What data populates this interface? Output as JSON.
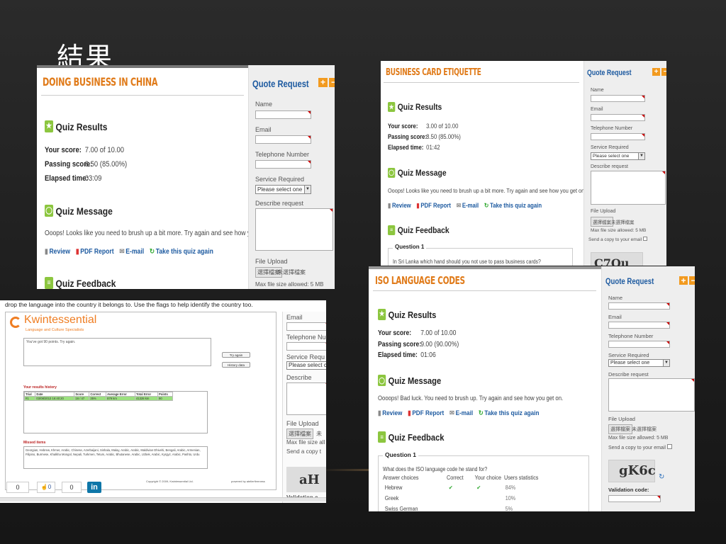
{
  "slide": {
    "title": "結果"
  },
  "quote": {
    "title": "Quote Request",
    "name": "Name",
    "email": "Email",
    "phone": "Telephone Number",
    "service": "Service Required",
    "select": "Please select one",
    "describe": "Describe request",
    "file_upload": "File Upload",
    "choose_file": "選擇檔案",
    "no_file": "未選擇檔案",
    "max_size": "Max file size allowed: 5 MB",
    "copy": "Send a copy to your email",
    "validation": "Validation code:"
  },
  "china": {
    "title": "DOING BUSINESS IN CHINA",
    "results_heading": "Quiz Results",
    "score_label": "Your score:",
    "score": "7.00 of 10.00",
    "passing_label": "Passing score:",
    "passing": "8.50 (85.00%)",
    "elapsed_label": "Elapsed time:",
    "elapsed": "03:09",
    "message_heading": "Quiz Message",
    "message": "Ooops! Looks like you need to brush up a bit more. Try again and see how you get on...",
    "feedback_heading": "Quiz Feedback",
    "links": [
      "Review",
      "PDF Report",
      "E-mail",
      "Take this quiz again"
    ],
    "max_size": "Max file size allowed: 5 MB"
  },
  "card": {
    "title": "BUSINESS CARD ETIQUETTE",
    "results_heading": "Quiz Results",
    "score_label": "Your score:",
    "score": "3.00 of 10.00",
    "passing_label": "Passing score:",
    "passing": "8.50 (85.00%)",
    "elapsed_label": "Elapsed time:",
    "elapsed": "01:42",
    "message_heading": "Quiz Message",
    "message": "Ooops! Looks like you need to brush up a bit more. Try again and see how you get on...",
    "feedback_heading": "Quiz Feedback",
    "question_label": "Question 1",
    "question": "In Sri Lanka which hand should you not use to pass business cards?",
    "links": [
      "Review",
      "PDF Report",
      "E-mail",
      "Take this quiz again"
    ],
    "max_size": "Max file size allowed: 5 MB",
    "captcha": "C7Ou"
  },
  "iso": {
    "title": "ISO LANGUAGE CODES",
    "results_heading": "Quiz Results",
    "score_label": "Your score:",
    "score": "7.00 of 10.00",
    "passing_label": "Passing score:",
    "passing": "9.00 (90.00%)",
    "elapsed_label": "Elapsed time:",
    "elapsed": "01:06",
    "message_heading": "Quiz Message",
    "message": "Oooops! Bad luck. You need to brush up. Try again and see how you get on.",
    "feedback_heading": "Quiz Feedback",
    "question_label": "Question 1",
    "question": "What does the ISO language code he stand for?",
    "cols": [
      "Answer choices",
      "Correct",
      "Your choice",
      "Users statistics"
    ],
    "answers": [
      {
        "choice": "Hebrew",
        "correct": "✔",
        "yours": "✔",
        "stat": "84%"
      },
      {
        "choice": "Greek",
        "correct": "",
        "yours": "",
        "stat": "10%"
      },
      {
        "choice": "Swiss German",
        "correct": "",
        "yours": "",
        "stat": "5%"
      }
    ],
    "links": [
      "Review",
      "PDF Report",
      "E-mail",
      "Take this quiz again"
    ],
    "max_size": "Max file size allowed: 5 MB",
    "captcha": "gK6c"
  },
  "game": {
    "instruction": "drop the language into the country it belongs to. Use the flags to help identify the country too.",
    "brand": "Kwintessential",
    "tagline": "Language and Culture Specialists",
    "result_text": "You've got 90 points. Try again.",
    "try_again": "Try again",
    "history": "History data",
    "history_title": "Your results history",
    "history_cols": [
      "Trial",
      "Date",
      "Score",
      "Correct",
      "Average Error",
      "Total Error",
      "Points"
    ],
    "history_row": [
      "#1",
      "03/08/2013 16:40:20",
      "16 / 47",
      "35%",
      "879 km",
      "41328 km",
      "90"
    ],
    "missed_title": "Missed items",
    "missed_text": "Georgian, Hebrew, Khmer, Arabic, Chinese, Azerbaijani, Sinhala, Malay, Arabic, Arabic, Maldivian Dhivehi, Bengali, Arabic, Armenian, Filipino, Burmese, Khalkha Mongol, Nepali, Turkmen, Tetum, Arabic, Bhutanese, Arabic, Uzbek, Arabic, Kyrgyz, Arabic, Pashto, Urdu",
    "copyright": "Copyright © 2009, Kwintessential Ltd.",
    "powered": "powered by atelierfirmness",
    "side_email": "Email",
    "side_phone": "Telephone Nu",
    "side_service": "Service Requ",
    "side_select": "Please select c",
    "side_describe": "Describe requ",
    "side_upload": "File Upload",
    "side_choose": "選擇檔案",
    "side_no_file": "未",
    "side_max": "Max file size all",
    "side_copy": "Send a copy t",
    "side_captcha": "aH",
    "side_validation": "Validation c",
    "share_counts": [
      "0",
      "0",
      "0"
    ],
    "linkedin": "in"
  }
}
